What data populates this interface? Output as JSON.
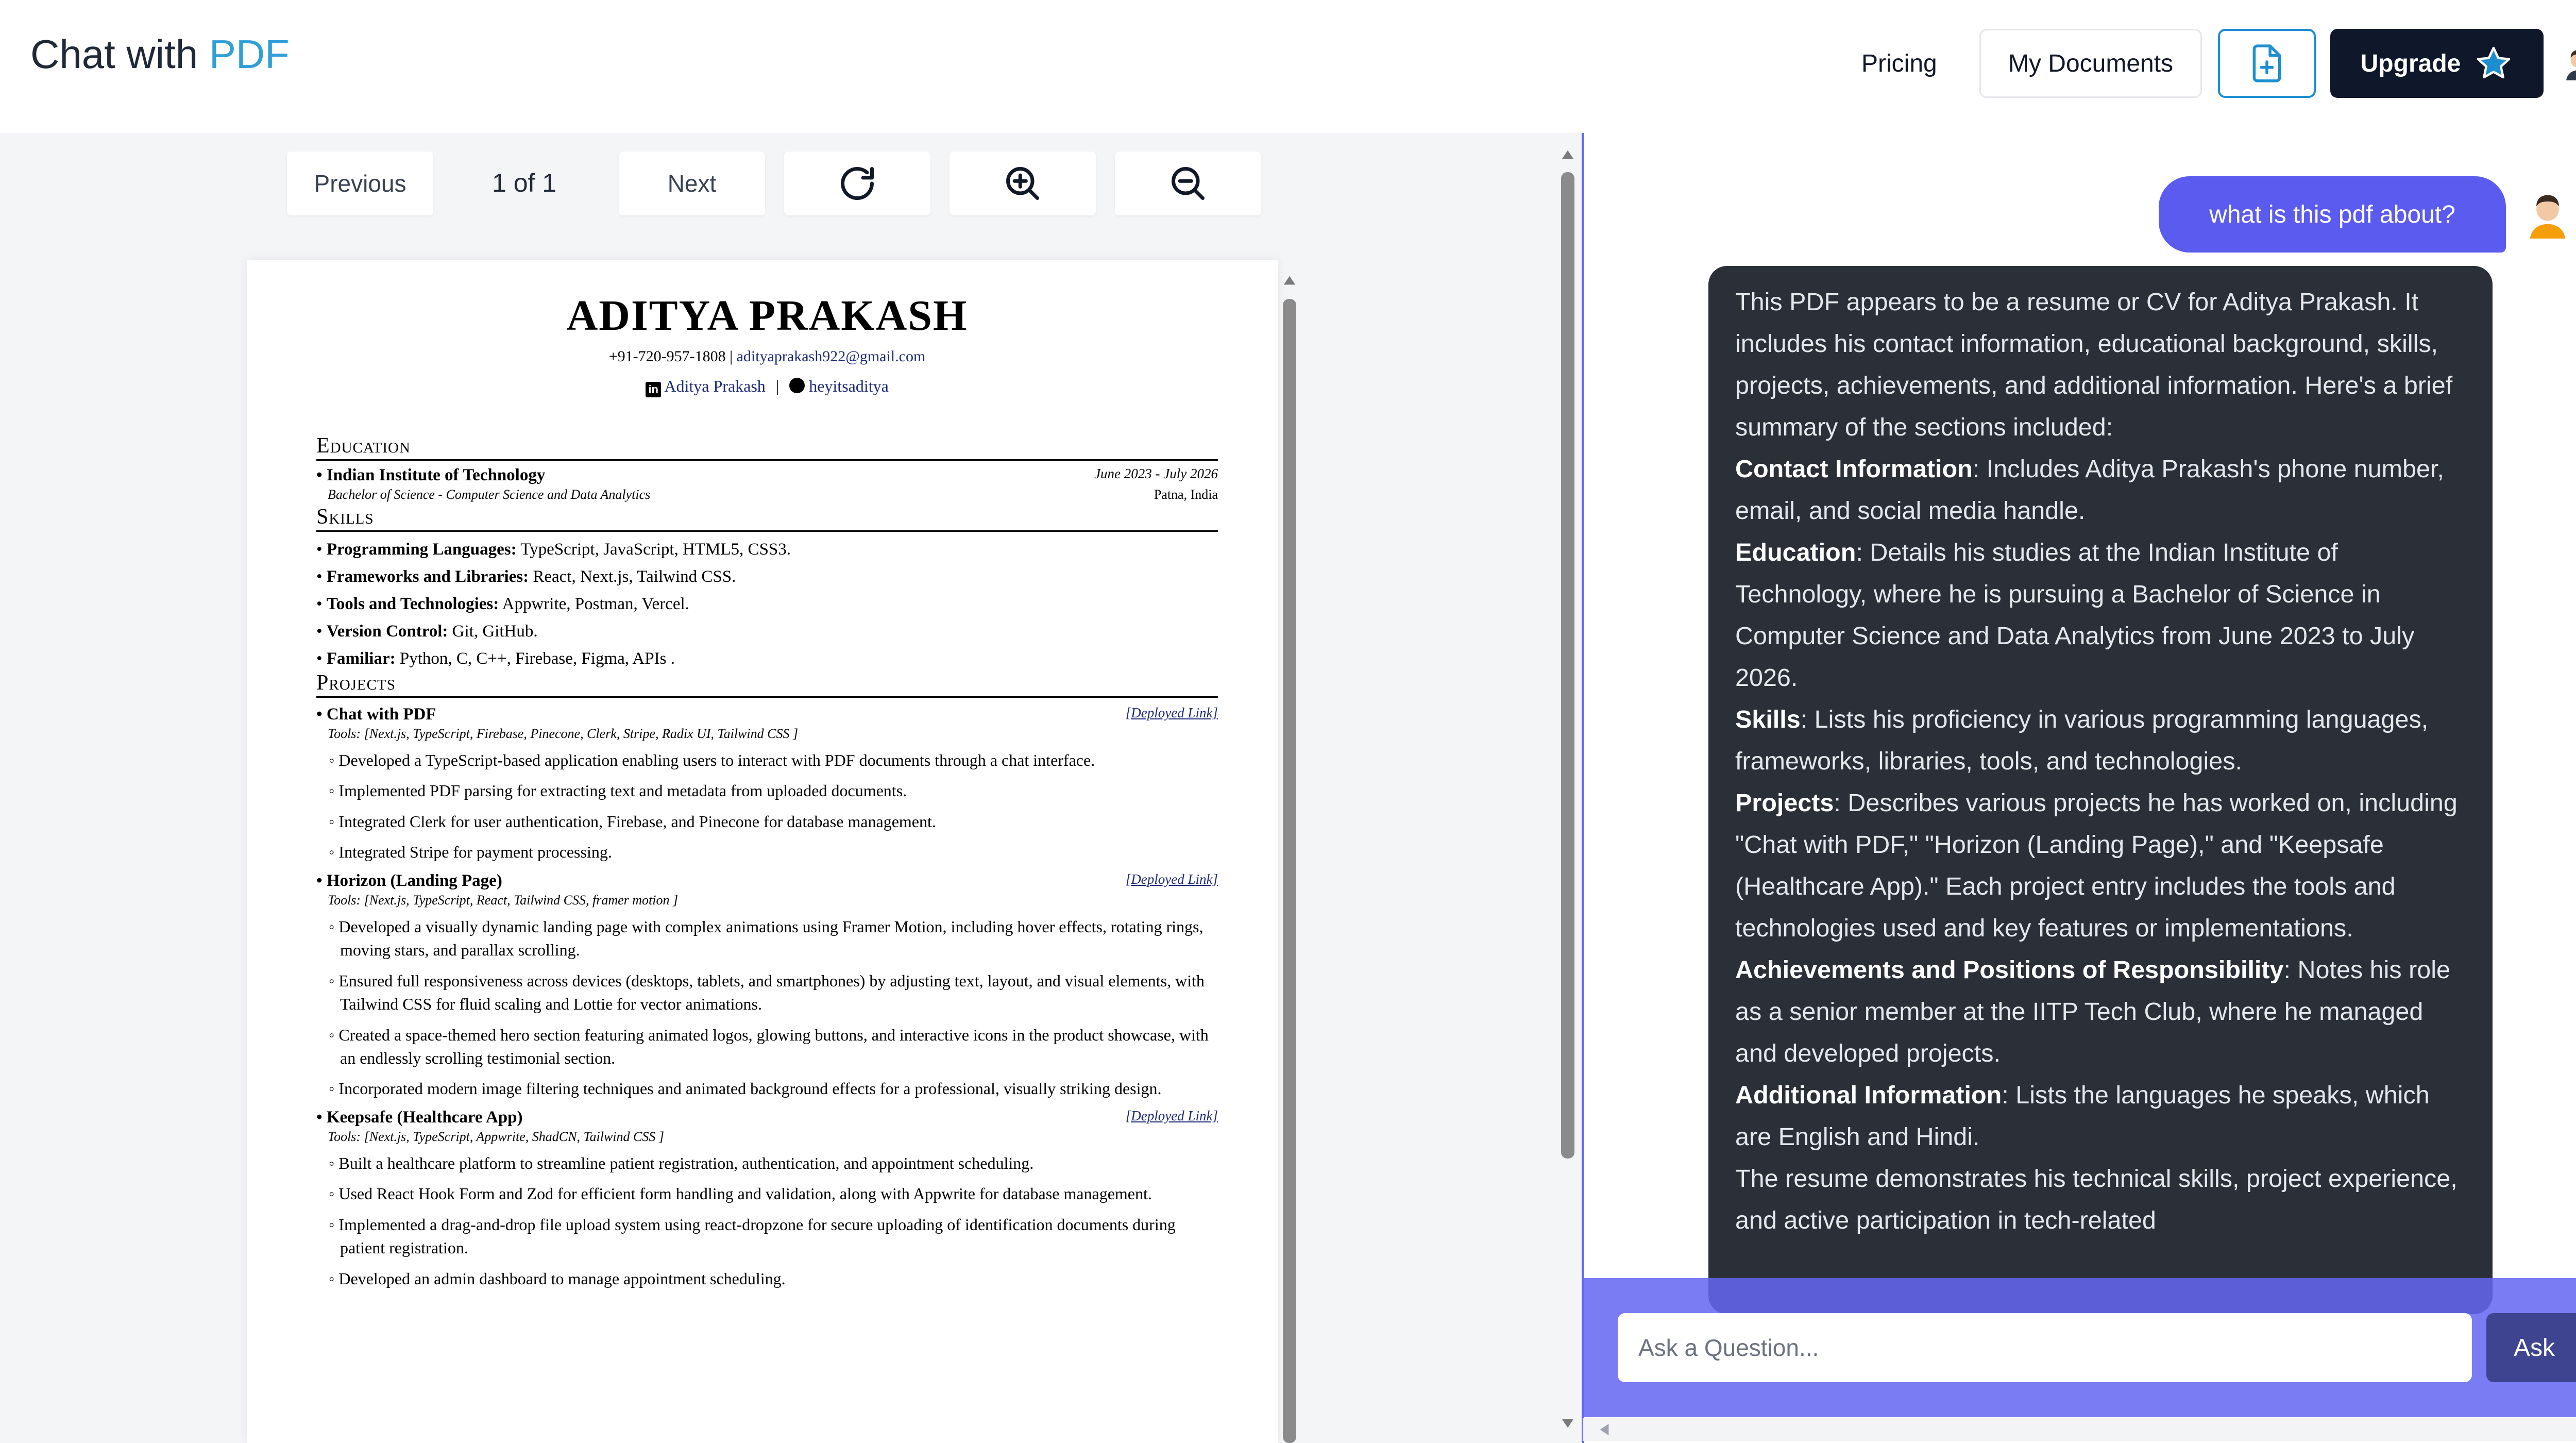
{
  "header": {
    "brand_prefix": "Chat with ",
    "brand_accent": "PDF",
    "pricing": "Pricing",
    "my_documents": "My Documents",
    "upgrade": "Upgrade",
    "upload_icon": "file-plus-icon",
    "star_icon": "star-icon",
    "avatar_icon": "user-avatar-icon"
  },
  "viewer": {
    "previous": "Previous",
    "page_indicator": "1 of 1",
    "next": "Next",
    "rotate_icon": "rotate-icon",
    "zoom_in_icon": "zoom-in-icon",
    "zoom_out_icon": "zoom-out-icon"
  },
  "resume": {
    "name": "ADITYA PRAKASH",
    "phone": "+91-720-957-1808",
    "email": "adityaprakash922@gmail.com",
    "linkedin": "Aditya Prakash",
    "github": "heyitsaditya",
    "education_title": "Education",
    "education": {
      "school": "Indian Institute of Technology",
      "dates": "June 2023 - July 2026",
      "degree": "Bachelor of Science - Computer Science and Data Analytics",
      "location": "Patna, India"
    },
    "skills_title": "Skills",
    "skills": [
      {
        "label": "Programming Languages:",
        "value": " TypeScript, JavaScript, HTML5, CSS3."
      },
      {
        "label": "Frameworks and Libraries:",
        "value": " React, Next.js, Tailwind CSS."
      },
      {
        "label": "Tools and Technologies:",
        "value": " Appwrite, Postman, Vercel."
      },
      {
        "label": "Version Control:",
        "value": " Git, GitHub."
      },
      {
        "label": "Familiar:",
        "value": " Python, C, C++, Firebase, Figma, APIs ."
      }
    ],
    "projects_title": "Projects",
    "projects": [
      {
        "name": "Chat with PDF",
        "link": "[Deployed Link]",
        "tools": "Tools: [Next.js, TypeScript, Firebase, Pinecone, Clerk, Stripe, Radix UI, Tailwind CSS ]",
        "items": [
          "Developed a TypeScript-based application enabling users to interact with PDF documents through a chat interface.",
          "Implemented PDF parsing for extracting text and metadata from uploaded documents.",
          "Integrated Clerk for user authentication, Firebase, and Pinecone for database management.",
          "Integrated Stripe for payment processing."
        ]
      },
      {
        "name": "Horizon (Landing Page)",
        "link": "[Deployed Link]",
        "tools": "Tools: [Next.js, TypeScript, React, Tailwind CSS, framer motion ]",
        "items": [
          "Developed a visually dynamic landing page with complex animations using Framer Motion, including hover effects, rotating rings, moving stars, and parallax scrolling.",
          "Ensured full responsiveness across devices (desktops, tablets, and smartphones) by adjusting text, layout, and visual elements, with Tailwind CSS for fluid scaling and Lottie for vector animations.",
          "Created a space-themed hero section featuring animated logos, glowing buttons, and interactive icons in the product showcase, with an endlessly scrolling testimonial section.",
          "Incorporated modern image filtering techniques and animated background effects for a professional, visually striking design."
        ]
      },
      {
        "name": "Keepsafe (Healthcare App)",
        "link": "[Deployed Link]",
        "tools": "Tools: [Next.js, TypeScript, Appwrite, ShadCN, Tailwind CSS ]",
        "items": [
          "Built a healthcare platform to streamline patient registration, authentication, and appointment scheduling.",
          "Used React Hook Form and Zod for efficient form handling and validation, along with Appwrite for database management.",
          "Implemented a drag-and-drop file upload system using react-dropzone for secure uploading of identification documents during patient registration.",
          "Developed an admin dashboard to manage appointment scheduling."
        ]
      }
    ]
  },
  "chat": {
    "user_message": "what is this pdf about?",
    "bot_intro": "This PDF appears to be a resume or CV for Aditya Prakash. It includes his contact information, educational background, skills, projects, achievements, and additional information. Here's a brief summary of the sections included:",
    "bot_sections": [
      {
        "label": "Contact Information",
        "text": ": Includes Aditya Prakash's phone number, email, and social media handle."
      },
      {
        "label": "Education",
        "text": ": Details his studies at the Indian Institute of Technology, where he is pursuing a Bachelor of Science in Computer Science and Data Analytics from June 2023 to July 2026."
      },
      {
        "label": "Skills",
        "text": ": Lists his proficiency in various programming languages, frameworks, libraries, tools, and technologies."
      },
      {
        "label": "Projects",
        "text": ": Describes various projects he has worked on, including \"Chat with PDF,\" \"Horizon (Landing Page),\" and \"Keepsafe (Healthcare App).\" Each project entry includes the tools and technologies used and key features or implementations."
      },
      {
        "label": "Achievements and Positions of Responsibility",
        "text": ": Notes his role as a senior member at the IITP Tech Club, where he managed and developed projects."
      },
      {
        "label": "Additional Information",
        "text": ": Lists the languages he speaks, which are English and Hindi."
      }
    ],
    "bot_outro": "The resume demonstrates his technical skills, project experience, and active participation in tech-related",
    "input_placeholder": "Ask a Question...",
    "ask": "Ask"
  },
  "colors": {
    "brand_accent": "#2f9fd8",
    "user_bubble": "#5b5bf0",
    "bot_bubble": "#2b3038",
    "input_bar": "#6366f1",
    "upgrade_bg": "#0f172a"
  }
}
